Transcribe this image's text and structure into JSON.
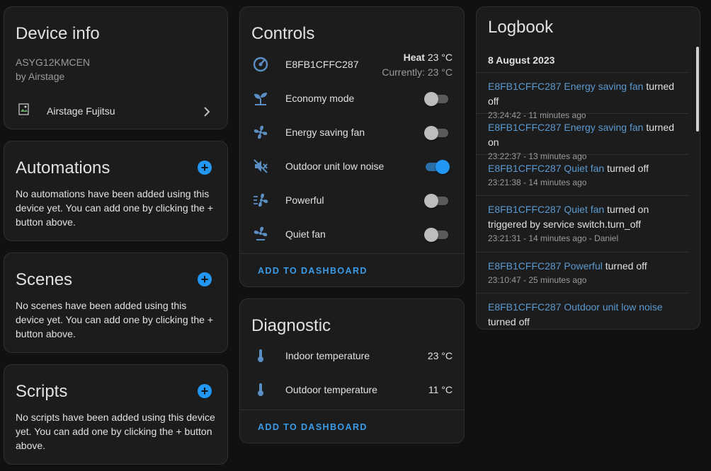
{
  "device_info": {
    "title": "Device info",
    "model": "ASYG12KMCEN",
    "manufacturer": "by Airstage",
    "integration": "Airstage Fujitsu"
  },
  "automations": {
    "title": "Automations",
    "message": "No automations have been added using this device yet. You can add one by clicking the + button above."
  },
  "scenes": {
    "title": "Scenes",
    "message": "No scenes have been added using this device yet. You can add one by clicking the + button above."
  },
  "scripts": {
    "title": "Scripts",
    "message": "No scripts have been added using this device yet. You can add one by clicking the + button above."
  },
  "controls": {
    "title": "Controls",
    "climate": {
      "name": "E8FB1CFFC287",
      "mode": "Heat",
      "target": "23 °C",
      "current": "Currently: 23 °C"
    },
    "switches": [
      {
        "label": "Economy mode",
        "icon": "sprout-icon",
        "on": false
      },
      {
        "label": "Energy saving fan",
        "icon": "fan-icon",
        "on": false
      },
      {
        "label": "Outdoor unit low noise",
        "icon": "volume-off-icon",
        "on": true
      },
      {
        "label": "Powerful",
        "icon": "fan-speed-icon",
        "on": false
      },
      {
        "label": "Quiet fan",
        "icon": "fan-low-icon",
        "on": false
      }
    ],
    "add_to_dashboard": "ADD TO DASHBOARD"
  },
  "diagnostic": {
    "title": "Diagnostic",
    "sensors": [
      {
        "label": "Indoor temperature",
        "value": "23 °C",
        "icon": "thermometer-icon"
      },
      {
        "label": "Outdoor temperature",
        "value": "11 °C",
        "icon": "thermometer-icon"
      }
    ],
    "add_to_dashboard": "ADD TO DASHBOARD"
  },
  "logbook": {
    "title": "Logbook",
    "date": "8 August 2023",
    "entries": [
      {
        "entity": "E8FB1CFFC287 Energy saving fan",
        "action": "turned off",
        "extra": "",
        "time": "23:24:42 - 11 minutes ago"
      },
      {
        "entity": "E8FB1CFFC287 Energy saving fan",
        "action": "turned on",
        "extra": "",
        "time": "23:22:37 - 13 minutes ago"
      },
      {
        "entity": "E8FB1CFFC287 Quiet fan",
        "action": "turned off",
        "extra": "",
        "time": "23:21:38 - 14 minutes ago"
      },
      {
        "entity": "E8FB1CFFC287 Quiet fan",
        "action": "turned on",
        "extra": "triggered by service switch.turn_off",
        "time": "23:21:31 - 14 minutes ago - Daniel"
      },
      {
        "entity": "E8FB1CFFC287 Powerful",
        "action": "turned off",
        "extra": "",
        "time": "23:10:47 - 25 minutes ago"
      },
      {
        "entity": "E8FB1CFFC287 Outdoor unit low noise",
        "action": "turned off",
        "extra": "",
        "time": ""
      }
    ]
  },
  "colors": {
    "accent": "#2196f3",
    "icon": "#5b8fc4",
    "background": "#111111",
    "card": "#1c1c1c"
  }
}
